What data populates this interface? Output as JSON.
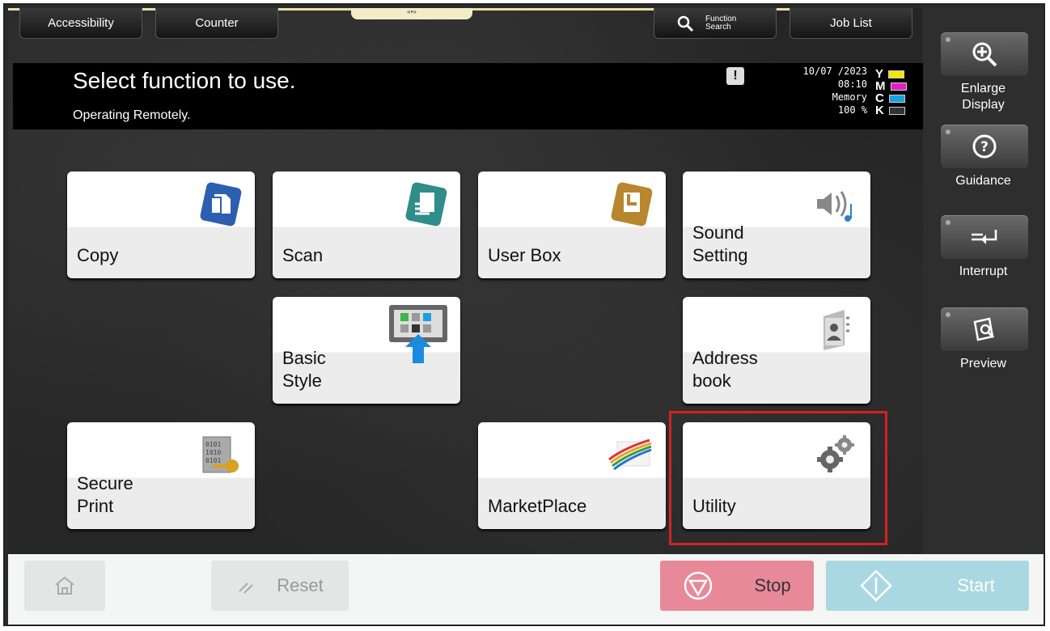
{
  "top_tabs": {
    "accessibility": "Accessibility",
    "counter": "Counter",
    "function_search": "Function Search",
    "job_list": "Job List"
  },
  "header": {
    "title": "Select function to use.",
    "subtitle": "Operating Remotely.",
    "date": "10/07 /2023",
    "time": "08:10",
    "memory_label": "Memory",
    "memory_value": "100 %",
    "toner": [
      {
        "letter": "Y",
        "color": "#f2e600"
      },
      {
        "letter": "M",
        "color": "#e020c0"
      },
      {
        "letter": "C",
        "color": "#1aa0e0"
      },
      {
        "letter": "K",
        "color": "#333333"
      }
    ]
  },
  "tiles": {
    "copy": "Copy",
    "scan": "Scan",
    "user_box": "User Box",
    "sound_setting": [
      "Sound",
      "Setting"
    ],
    "basic_style": [
      "Basic",
      "Style"
    ],
    "address_book": [
      "Address",
      "book"
    ],
    "secure_print": [
      "Secure",
      "Print"
    ],
    "marketplace": "MarketPlace",
    "utility": "Utility"
  },
  "side": {
    "enlarge": [
      "Enlarge",
      "Display"
    ],
    "guidance": "Guidance",
    "interrupt": "Interrupt",
    "preview": "Preview"
  },
  "bottom": {
    "reset": "Reset",
    "stop": "Stop",
    "start": "Start"
  }
}
